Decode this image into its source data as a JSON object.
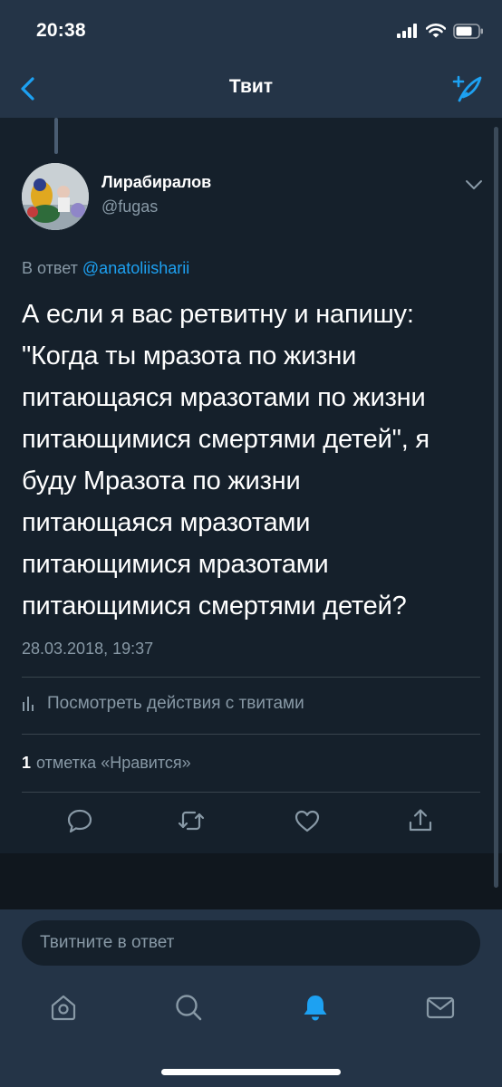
{
  "status_bar": {
    "time": "20:38"
  },
  "nav": {
    "title": "Твит"
  },
  "tweet": {
    "author_name": "Лирабиралов",
    "author_handle": "@fugas",
    "reply_prefix": "В ответ",
    "reply_mention": "@anatoliisharii",
    "text": "А если я вас ретвитну и напишу:\n\"Когда ты мразота по жизни\nпитающаяся мразотами по жизни\nпитающимися смертями детей\", я\nбуду Мразота по жизни\nпитающаяся мразотами\nпитающимися мразотами\nпитающимися смертями детей?",
    "timestamp": "28.03.2018, 19:37",
    "activity_label": "Посмотреть действия с твитами",
    "likes_count": "1",
    "likes_label": "отметка «Нравится»"
  },
  "reply_input": {
    "placeholder": "Твитните в ответ"
  },
  "colors": {
    "background": "#15202b",
    "bar": "#243447",
    "accent": "#1da1f2",
    "muted": "#8899a6"
  },
  "icons": {
    "actions": [
      "reply-icon",
      "retweet-icon",
      "like-icon",
      "share-icon"
    ],
    "tabs": [
      "home-icon",
      "search-icon",
      "notifications-icon",
      "messages-icon"
    ],
    "active_tab": "notifications-icon"
  }
}
